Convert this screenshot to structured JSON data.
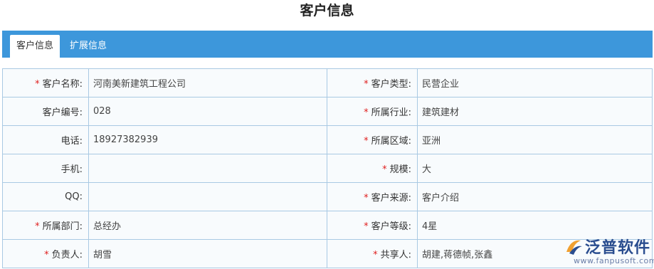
{
  "page": {
    "title": "客户信息"
  },
  "tabs": [
    {
      "label": "客户信息",
      "active": true
    },
    {
      "label": "扩展信息",
      "active": false
    }
  ],
  "rows": [
    {
      "left": {
        "label": "客户名称:",
        "required": true,
        "value": "河南美新建筑工程公司"
      },
      "right": {
        "label": "客户类型:",
        "required": true,
        "value": "民营企业"
      }
    },
    {
      "left": {
        "label": "客户编号:",
        "required": false,
        "value": "028"
      },
      "right": {
        "label": "所属行业:",
        "required": true,
        "value": "建筑建材"
      }
    },
    {
      "left": {
        "label": "电话:",
        "required": false,
        "value": "18927382939"
      },
      "right": {
        "label": "所属区域:",
        "required": true,
        "value": "亚洲"
      }
    },
    {
      "left": {
        "label": "手机:",
        "required": false,
        "value": ""
      },
      "right": {
        "label": "规模:",
        "required": true,
        "value": "大"
      }
    },
    {
      "left": {
        "label": "QQ:",
        "required": false,
        "value": ""
      },
      "right": {
        "label": "客户来源:",
        "required": true,
        "value": "客户介绍"
      }
    },
    {
      "left": {
        "label": "所属部门:",
        "required": true,
        "value": "总经办"
      },
      "right": {
        "label": "客户等级:",
        "required": true,
        "value": "4星"
      }
    },
    {
      "left": {
        "label": "负责人:",
        "required": true,
        "value": "胡雪"
      },
      "right": {
        "label": "共享人:",
        "required": true,
        "value": "胡建,蒋德帧,张鑫"
      }
    }
  ],
  "required_mark": "*",
  "watermark": {
    "name": "泛普软件",
    "url": "www.fanpusoft.com"
  },
  "colors": {
    "tabbar": "#3d97db",
    "border": "#a9c9e3",
    "required": "#e02020",
    "brand": "#2a4d8f"
  }
}
